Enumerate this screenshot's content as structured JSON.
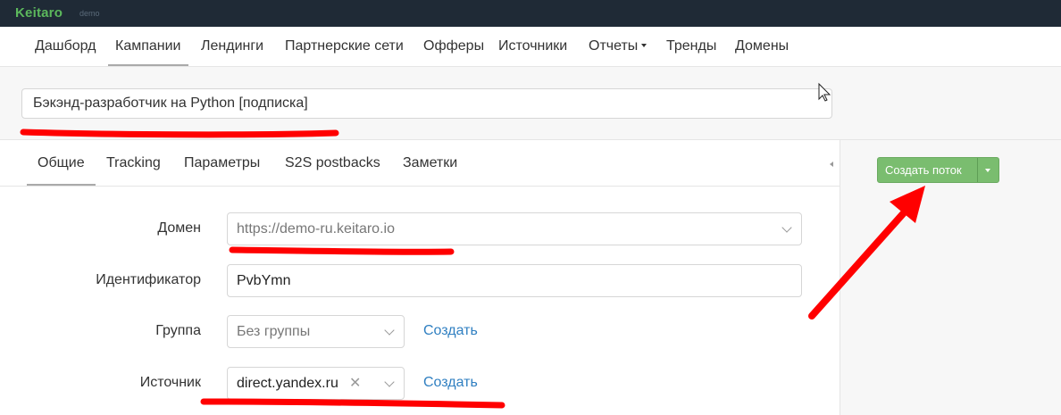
{
  "brand": {
    "name": "Keitaro",
    "tagline": "demo"
  },
  "nav": {
    "items": [
      {
        "label": "Дашборд"
      },
      {
        "label": "Кампании"
      },
      {
        "label": "Лендинги"
      },
      {
        "label": "Партнерские сети"
      },
      {
        "label": "Офферы"
      },
      {
        "label": "Источники"
      },
      {
        "label": "Отчеты"
      },
      {
        "label": "Тренды"
      },
      {
        "label": "Домены"
      }
    ],
    "active_index": 1
  },
  "campaign": {
    "name": "Бэкэнд-разработчик на Python [подписка]"
  },
  "tabs": {
    "items": [
      {
        "label": "Общие"
      },
      {
        "label": "Tracking"
      },
      {
        "label": "Параметры"
      },
      {
        "label": "S2S postbacks"
      },
      {
        "label": "Заметки"
      }
    ],
    "active_index": 0
  },
  "sidebar": {
    "create_flow_label": "Создать поток"
  },
  "form": {
    "domain": {
      "label": "Домен",
      "value": "https://demo-ru.keitaro.io"
    },
    "identifier": {
      "label": "Идентификатор",
      "value": "PvbYmn"
    },
    "group": {
      "label": "Группа",
      "value": "Без группы",
      "create_link": "Создать"
    },
    "source": {
      "label": "Источник",
      "value": "direct.yandex.ru",
      "create_link": "Создать"
    }
  },
  "colors": {
    "topbar": "#1f2a36",
    "brand_green": "#5cb85c",
    "button_green": "#7abd6f",
    "link_blue": "#2f7fc1",
    "annotation_red": "#ff0000"
  },
  "icons": [
    "chevron-down-icon",
    "clear-x-icon",
    "caret-down-icon",
    "caret-left-icon",
    "mouse-cursor-icon",
    "annotation-arrow"
  ]
}
